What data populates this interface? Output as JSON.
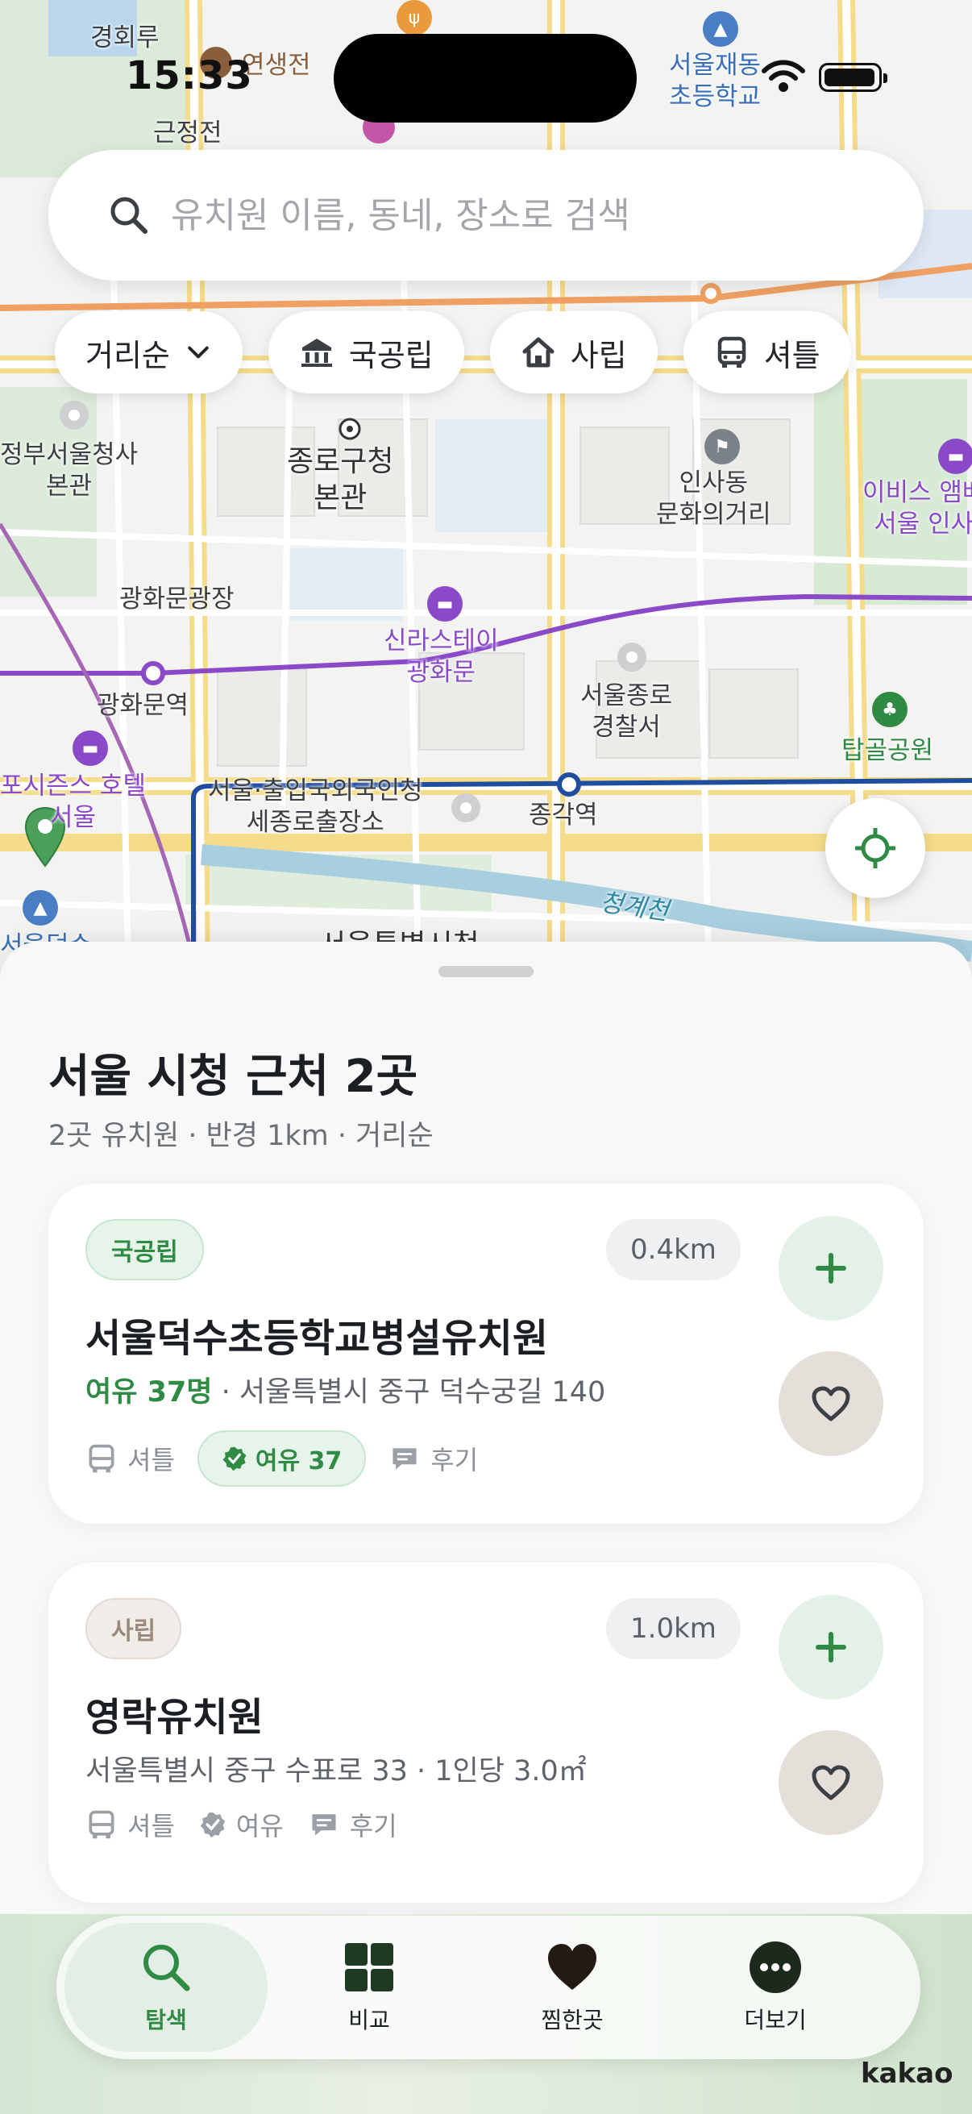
{
  "status_bar": {
    "time": "15:33"
  },
  "search": {
    "placeholder": "유치원 이름, 동네, 장소로 검색"
  },
  "chips": [
    {
      "label": "거리순",
      "icon": "chevron-down-icon"
    },
    {
      "label": "국공립",
      "icon": "bank-icon"
    },
    {
      "label": "사립",
      "icon": "home-icon"
    },
    {
      "label": "셔틀",
      "icon": "bus-icon"
    }
  ],
  "map": {
    "labels": {
      "gyeonghoeru": "경회루",
      "yeonsaengjeon": "연생전",
      "geunjeongjeon": "근정전",
      "jaedong_school": "서울재동\n초등학교",
      "seoul_gov": "정부서울청사\n본관",
      "jongno_office": "종로구청\n본관",
      "insadong": "인사동\n문화의거리",
      "ibis": "이비스 앰배\n서울 인사",
      "gwanghwamun_plaza": "광화문광장",
      "shilla_stay": "신라스테이\n광화문",
      "gwanghwamun_station": "광화문역",
      "jongno_police": "서울종로\n경찰서",
      "tapgol_park": "탑골공원",
      "four_seasons": "포시즌스 호텔\n서울",
      "immigration": "서울·출입국외국인청\n세종로출장소",
      "jonggak_station": "종각역",
      "cheonggyecheon": "청계천",
      "city_hall": "서울특별시청\n무교로청사",
      "deoksu": "서울덕수",
      "kakao": "kakao"
    }
  },
  "sheet": {
    "title": "서울 시청 근처 2곳",
    "subtitle": "2곳 유치원 · 반경 1km · 거리순"
  },
  "cards": [
    {
      "badge": "국공립",
      "distance": "0.4km",
      "name": "서울덕수초등학교병설유치원",
      "vacancy_text": "여유 37명",
      "address": " · 서울특별시 중구 덕수궁길 140",
      "meta_shuttle": "셔틀",
      "meta_vacancy": "여유 37",
      "meta_review": "후기"
    },
    {
      "badge": "사립",
      "distance": "1.0km",
      "name": "영락유치원",
      "address": "서울특별시 중구 수표로 33 · 1인당 3.0㎡",
      "meta_shuttle": "셔틀",
      "meta_vacancy": "여유",
      "meta_review": "후기"
    }
  ],
  "tabs": [
    {
      "label": "탐색",
      "icon": "search-icon",
      "active": true
    },
    {
      "label": "비교",
      "icon": "grid-icon",
      "active": false
    },
    {
      "label": "찜한곳",
      "icon": "heart-icon",
      "active": false
    },
    {
      "label": "더보기",
      "icon": "more-icon",
      "active": false
    }
  ],
  "colors": {
    "accent": "#2f8a44",
    "subway_purple": "#8a49c9",
    "subway_blue": "#1f4ea0"
  }
}
